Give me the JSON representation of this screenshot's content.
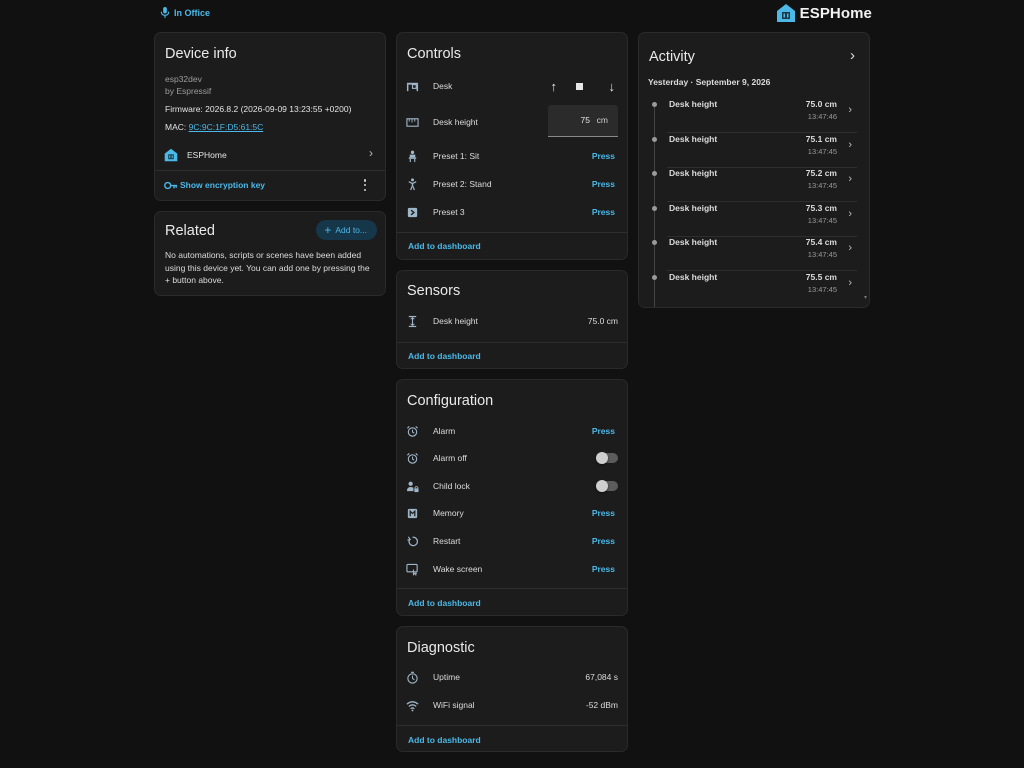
{
  "header": {
    "area": "In Office",
    "brand": "ESPHome"
  },
  "device_info": {
    "title": "Device info",
    "model": "esp32dev",
    "manufacturer": "by Espressif",
    "firmware": "Firmware: 2026.8.2 (2026-09-09 13:23:55 +0200)",
    "mac_label": "MAC:",
    "mac_value": "9C:9C:1F:D5:61:5C",
    "integration": "ESPHome",
    "encryption_link": "Show encryption key"
  },
  "related": {
    "title": "Related",
    "add_button": "Add to...",
    "message": "No automations, scripts or scenes have been added using this device yet. You can add one by pressing the + button above."
  },
  "controls": {
    "title": "Controls",
    "desk_label": "Desk",
    "height_label": "Desk height",
    "height_value": "75",
    "height_unit": "cm",
    "preset1": "Preset 1: Sit",
    "preset2": "Preset 2: Stand",
    "preset3": "Preset 3",
    "press": "Press",
    "add_to_dashboard": "Add to dashboard"
  },
  "sensors": {
    "title": "Sensors",
    "height_label": "Desk height",
    "height_value": "75.0 cm",
    "add_to_dashboard": "Add to dashboard"
  },
  "configuration": {
    "title": "Configuration",
    "alarm": "Alarm",
    "alarm_off": "Alarm off",
    "child_lock": "Child lock",
    "memory": "Memory",
    "restart": "Restart",
    "wake_screen": "Wake screen",
    "press": "Press",
    "add_to_dashboard": "Add to dashboard",
    "alarm_off_state": false,
    "child_lock_state": false
  },
  "diagnostic": {
    "title": "Diagnostic",
    "uptime_label": "Uptime",
    "uptime_value": "67,084 s",
    "wifi_label": "WiFi signal",
    "wifi_value": "-52 dBm",
    "add_to_dashboard": "Add to dashboard"
  },
  "activity": {
    "title": "Activity",
    "date_heading": "Yesterday · September 9, 2026",
    "items": [
      {
        "name": "Desk height",
        "value": "75.0 cm",
        "time": "13:47:46"
      },
      {
        "name": "Desk height",
        "value": "75.1 cm",
        "time": "13:47:45"
      },
      {
        "name": "Desk height",
        "value": "75.2 cm",
        "time": "13:47:45"
      },
      {
        "name": "Desk height",
        "value": "75.3 cm",
        "time": "13:47:45"
      },
      {
        "name": "Desk height",
        "value": "75.4 cm",
        "time": "13:47:45"
      },
      {
        "name": "Desk height",
        "value": "75.5 cm",
        "time": "13:47:45"
      }
    ]
  },
  "colors": {
    "background": "#111111",
    "card": "#1c1c1c",
    "accent": "#4bb8e8",
    "text": "#e1e1e1",
    "secondary_text": "#9c9c9c"
  },
  "icons": {
    "area": "microphone-icon",
    "brand": "esphome-house-icon",
    "desk": "desk-icon",
    "height": "ruler-icon",
    "preset_sit": "sitting-person-icon",
    "preset_stand": "standing-person-icon",
    "preset3": "right-arrow-box-icon",
    "sensor": "arrow-expand-vertical-icon",
    "alarm": "alarm-clock-icon",
    "child_lock": "account-lock-icon",
    "memory": "memory-icon",
    "restart": "restart-icon",
    "wake_screen": "monitor-touch-icon",
    "uptime": "timer-icon",
    "wifi": "wifi-icon",
    "encryption": "key-icon"
  }
}
